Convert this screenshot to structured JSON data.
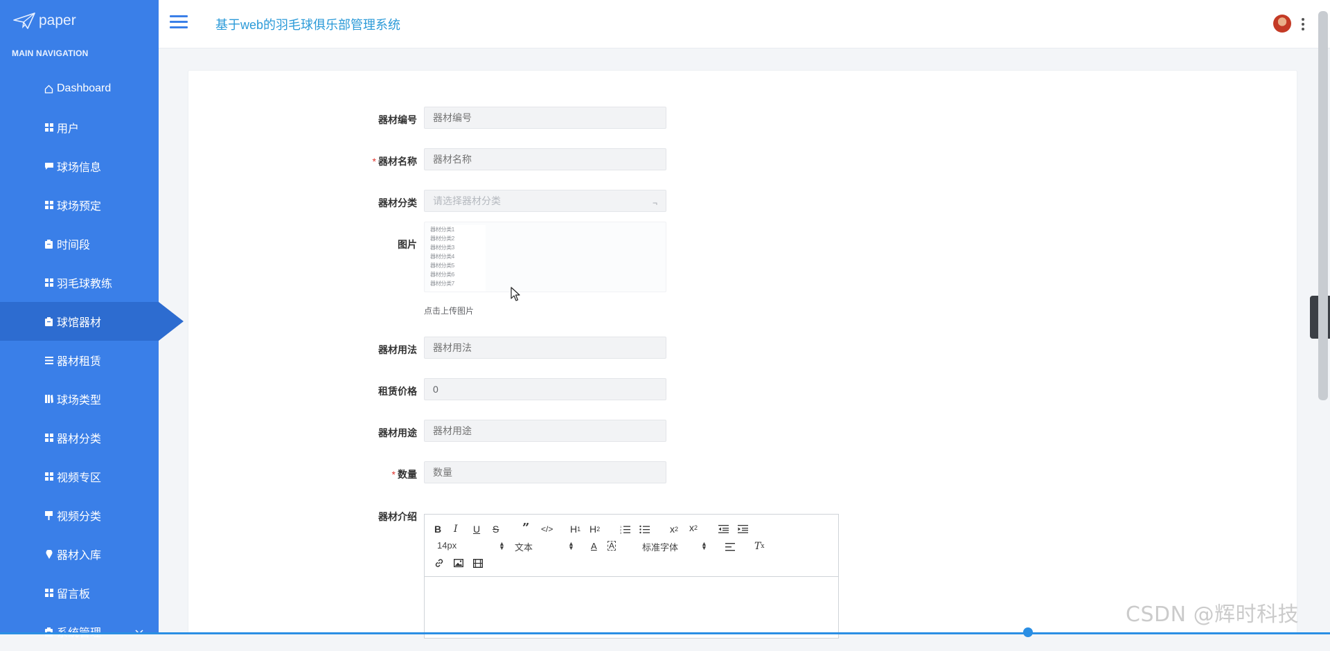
{
  "brand": {
    "logo_text": "paper"
  },
  "header": {
    "title": "基于web的羽毛球俱乐部管理系统"
  },
  "sidebar": {
    "section_title": "MAIN NAVIGATION",
    "items": [
      {
        "label": "Dashboard",
        "icon": "home-icon"
      },
      {
        "label": "用户",
        "icon": "grid-icon"
      },
      {
        "label": "球场信息",
        "icon": "chat-icon"
      },
      {
        "label": "球场预定",
        "icon": "grid-icon"
      },
      {
        "label": "时间段",
        "icon": "clipboard-icon"
      },
      {
        "label": "羽毛球教练",
        "icon": "grid-icon"
      },
      {
        "label": "球馆器材",
        "icon": "clipboard-icon",
        "active": true
      },
      {
        "label": "器材租赁",
        "icon": "list-icon"
      },
      {
        "label": "球场类型",
        "icon": "book-icon"
      },
      {
        "label": "器材分类",
        "icon": "grid-icon"
      },
      {
        "label": "视频专区",
        "icon": "grid-icon"
      },
      {
        "label": "视频分类",
        "icon": "sign-icon"
      },
      {
        "label": "器材入库",
        "icon": "pin-icon"
      },
      {
        "label": "留言板",
        "icon": "grid-icon"
      },
      {
        "label": "系统管理",
        "icon": "clipboard-icon",
        "has_submenu": true
      }
    ]
  },
  "form": {
    "code": {
      "label": "器材编号",
      "placeholder": "器材编号",
      "required": false
    },
    "name": {
      "label": "器材名称",
      "placeholder": "器材名称",
      "required": true
    },
    "category": {
      "label": "器材分类",
      "placeholder": "请选择器材分类",
      "required": false
    },
    "image": {
      "label": "图片",
      "hint": "点击上传图片",
      "thumbnail_lines": [
        "器材分类1",
        "器材分类2",
        "器材分类3",
        "器材分类4",
        "器材分类5",
        "器材分类6",
        "器材分类7"
      ]
    },
    "usage": {
      "label": "器材用法",
      "placeholder": "器材用法",
      "required": false
    },
    "price": {
      "label": "租赁价格",
      "value": "0",
      "required": false
    },
    "purpose": {
      "label": "器材用途",
      "placeholder": "器材用途",
      "required": false
    },
    "quantity": {
      "label": "数量",
      "placeholder": "数量",
      "required": true
    },
    "intro": {
      "label": "器材介绍"
    }
  },
  "editor": {
    "font_size": "14px",
    "header_select": "文本",
    "font_family": "标准字体",
    "buttons": [
      "bold",
      "italic",
      "underline",
      "strike",
      "blockquote",
      "code-block",
      "h1",
      "h2",
      "ordered-list",
      "bullet-list",
      "subscript",
      "superscript",
      "outdent",
      "indent",
      "color",
      "background",
      "align",
      "clean",
      "link",
      "image",
      "video"
    ]
  },
  "watermark": "CSDN @辉时科技"
}
